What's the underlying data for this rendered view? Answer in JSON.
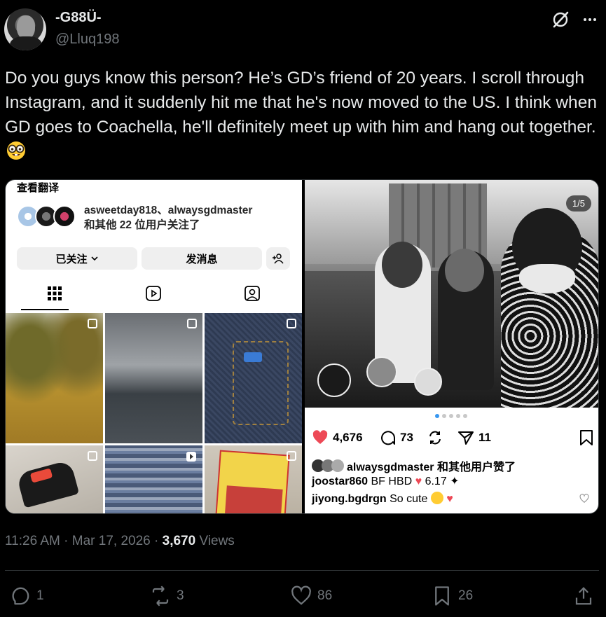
{
  "author": {
    "display_name": "-G88Ü-",
    "handle": "@Lluq198"
  },
  "tweet": {
    "text": "Do you guys know this person? He’s GD’s friend of 20 years. I  scroll through Instagram, and it suddenly hit me that he's now moved to the US. I think when GD goes to Coachella, he'll definitely meet up with him and hang out together.",
    "emoji": "nerd-face"
  },
  "instagram_profile": {
    "translate_label": "查看翻译",
    "followed_by_line1": "asweetday818、alwaysgdmaster",
    "followed_by_line2": "和其他 22 位用户关注了",
    "following_button": "已关注",
    "message_button": "发消息"
  },
  "instagram_post": {
    "page_indicator": "1/5",
    "likes": "4,676",
    "comments": "73",
    "shares": "11",
    "liked_by": "alwaysgdmaster 和其他用户赞了",
    "comments_list": [
      {
        "user": "joostar860",
        "text": "BF HBD",
        "extra": "6.17"
      },
      {
        "user": "jiyong.bgdrgn",
        "text": "So cute"
      }
    ]
  },
  "meta": {
    "time": "11:26 AM",
    "separator": "·",
    "date": "Mar 17, 2026",
    "views_count": "3,670",
    "views_label": "Views"
  },
  "engagement": {
    "replies": "1",
    "reposts": "3",
    "likes": "86",
    "bookmarks": "26"
  },
  "colors": {
    "background": "#000000",
    "text": "#e7e9ea",
    "muted": "#71767b",
    "divider": "#2f3336",
    "ig_heart": "#ed4956"
  }
}
